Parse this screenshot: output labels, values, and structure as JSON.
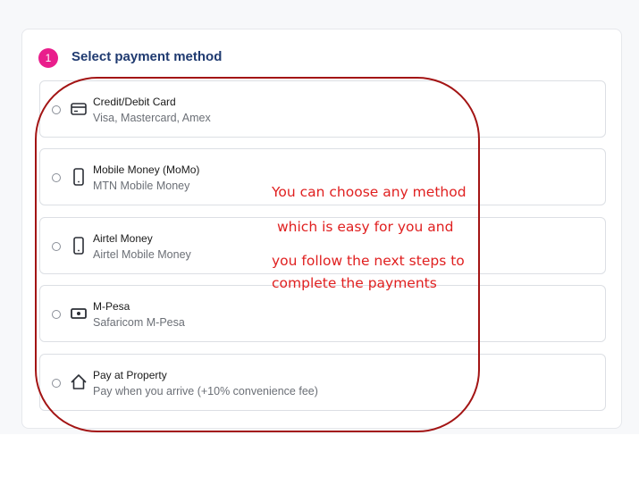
{
  "section": {
    "step_number": "1",
    "title": "Select payment method"
  },
  "payment_options": [
    {
      "label": "Credit/Debit Card",
      "description": "Visa, Mastercard, Amex",
      "icon": "credit-card-icon",
      "selected": false
    },
    {
      "label": "Mobile Money (MoMo)",
      "description": "MTN Mobile Money",
      "icon": "mobile-phone-icon",
      "selected": false
    },
    {
      "label": "Airtel Money",
      "description": "Airtel Mobile Money",
      "icon": "mobile-phone-icon",
      "selected": false
    },
    {
      "label": "M-Pesa",
      "description": "Safaricom M-Pesa",
      "icon": "cash-icon",
      "selected": false
    },
    {
      "label": "Pay at Property",
      "description": "Pay when you arrive (+10% convenience fee)",
      "icon": "home-icon",
      "selected": false
    }
  ],
  "annotation": {
    "lines": [
      "You can choose any method",
      "which is easy for you and",
      "you follow the next steps to",
      "complete the payments"
    ],
    "color": "#e02020",
    "outline_color": "#a31414"
  },
  "colors": {
    "accent": "#e91e8c",
    "title": "#1f3a70"
  }
}
